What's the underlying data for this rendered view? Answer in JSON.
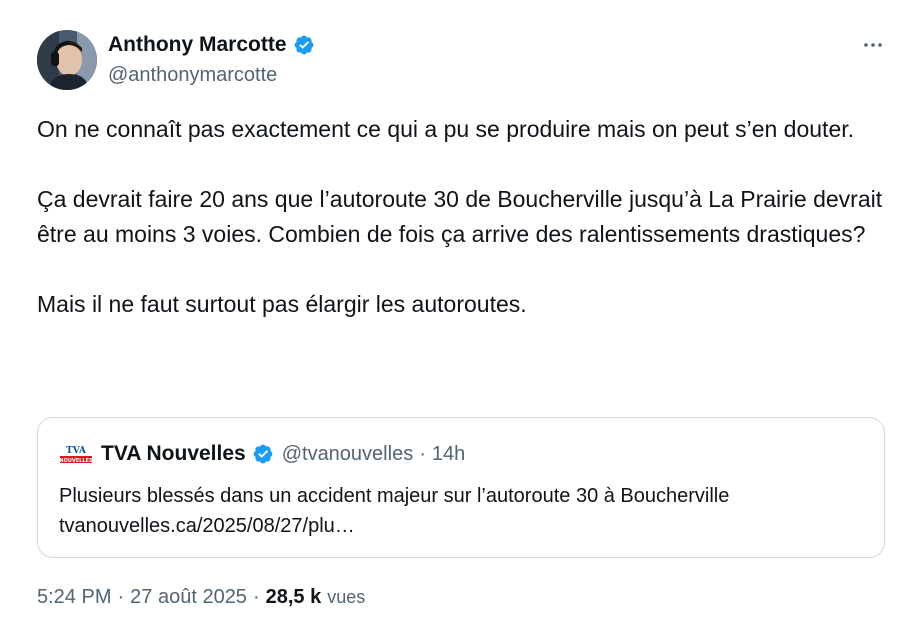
{
  "author": {
    "name": "Anthony Marcotte",
    "handle": "@anthonymarcotte",
    "verified_icon": "verified-badge-icon",
    "avatar_icon": "avatar-photo"
  },
  "more_icon": "more-horizontal-icon",
  "tweet": {
    "paragraphs": [
      "On ne connaît pas exactement ce qui a pu se produire mais on peut s’en douter.",
      "Ça devrait faire 20 ans que l’autoroute 30 de Boucherville jusqu’à La Prairie devrait être au moins 3 voies. Combien de fois ça arrive des ralentissements drastiques?",
      "Mais il ne faut surtout pas élargir les autoroutes."
    ]
  },
  "quote": {
    "logo_text": "TVA NOUVELLES",
    "name": "TVA Nouvelles",
    "handle": "@tvanouvelles",
    "separator": "·",
    "time": "14h",
    "text": "Plusieurs blessés dans un accident majeur sur l’autoroute 30 à Boucherville",
    "link": "tvanouvelles.ca/2025/08/27/plu…"
  },
  "meta": {
    "time": "5:24 PM",
    "separator": "·",
    "date": "27 août 2025",
    "views_count": "28,5 k",
    "views_label": "vues"
  },
  "colors": {
    "verified_blue": "#1d9bf0",
    "secondary_text": "#536471",
    "border": "#cfd9de",
    "tva_red": "#d7191f",
    "tva_blue": "#0a4b9b"
  }
}
